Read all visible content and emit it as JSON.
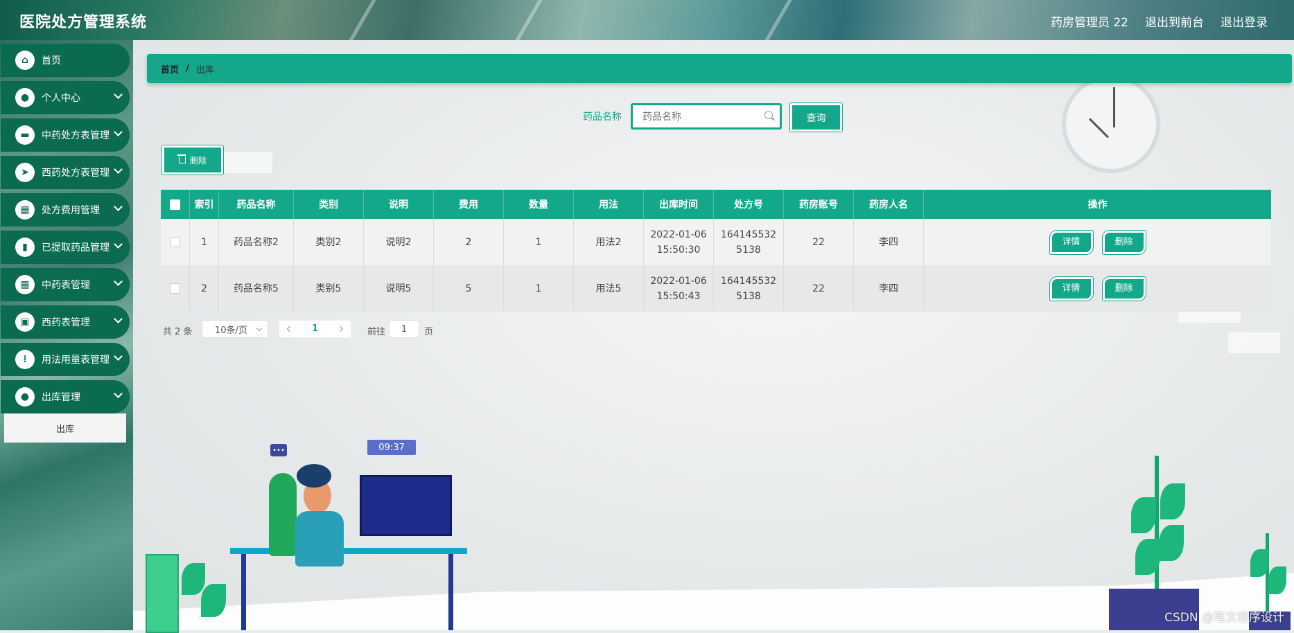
{
  "header": {
    "app_title": "医院处方管理系统",
    "user_label": "药房管理员 22",
    "front_link": "退出到前台",
    "logout_link": "退出登录"
  },
  "sidebar": {
    "items": [
      {
        "label": "首页",
        "icon": "home-icon"
      },
      {
        "label": "个人中心",
        "icon": "user-icon"
      },
      {
        "label": "中药处方表管理",
        "icon": "monitor-icon"
      },
      {
        "label": "西药处方表管理",
        "icon": "send-icon"
      },
      {
        "label": "处方费用管理",
        "icon": "grid-icon"
      },
      {
        "label": "已提取药品管理",
        "icon": "book-icon"
      },
      {
        "label": "中药表管理",
        "icon": "grid-icon"
      },
      {
        "label": "西药表管理",
        "icon": "briefcase-icon"
      },
      {
        "label": "用法用量表管理",
        "icon": "apps-icon"
      },
      {
        "label": "出库管理",
        "icon": "user-icon"
      }
    ],
    "submenu_item": "出库"
  },
  "breadcrumb": {
    "home": "首页",
    "separator": "/",
    "current": "出库"
  },
  "search": {
    "label": "药品名称",
    "placeholder": "药品名称",
    "button": "查询"
  },
  "toolbar": {
    "delete_label": "删除"
  },
  "table": {
    "columns": [
      "",
      "索引",
      "药品名称",
      "类别",
      "说明",
      "费用",
      "数量",
      "用法",
      "出库时间",
      "处方号",
      "药房账号",
      "药房人名",
      "操作"
    ],
    "rows": [
      {
        "index": "1",
        "name": "药品名称2",
        "category": "类别2",
        "note": "说明2",
        "fee": "2",
        "qty": "1",
        "usage": "用法2",
        "time": "2022-01-06 15:50:30",
        "prescription": "1641455325138",
        "account": "22",
        "person": "李四"
      },
      {
        "index": "2",
        "name": "药品名称5",
        "category": "类别5",
        "note": "说明5",
        "fee": "5",
        "qty": "1",
        "usage": "用法5",
        "time": "2022-01-06 15:50:43",
        "prescription": "1641455325138",
        "account": "22",
        "person": "李四"
      }
    ],
    "detail_label": "详情",
    "delete_label": "删除"
  },
  "pagination": {
    "total": "共 2 条",
    "page_size": "10条/页",
    "current_page": "1",
    "goto_label": "前往",
    "goto_value": "1",
    "page_suffix": "页"
  },
  "decor": {
    "time_badge": "09:37",
    "watermark": "CSDN @笔文程序设计"
  },
  "colors": {
    "accent": "#13a88a",
    "sidebar_item": "#0b6b50"
  }
}
